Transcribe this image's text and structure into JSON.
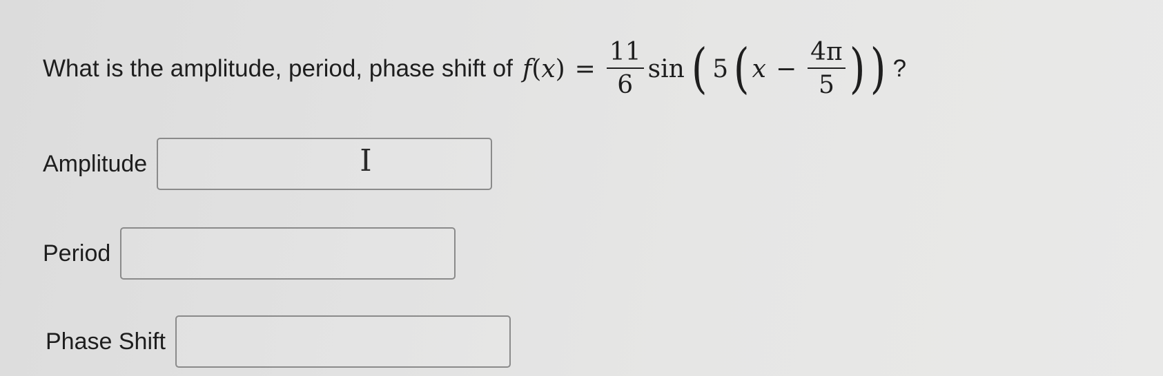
{
  "question": {
    "prefix": "What is the amplitude, period, phase shift of",
    "func_name": "f",
    "var": "x",
    "equals": "=",
    "coef_num": "11",
    "coef_den": "6",
    "trig_fn": "sin",
    "inner_coef": "5",
    "minus": "−",
    "shift_num": "4π",
    "shift_den": "5",
    "suffix": "?"
  },
  "fields": {
    "amplitude": {
      "label": "Amplitude",
      "value": ""
    },
    "period": {
      "label": "Period",
      "value": ""
    },
    "phase_shift": {
      "label": "Phase Shift",
      "value": ""
    }
  },
  "cursor_icon": "text-cursor-icon"
}
